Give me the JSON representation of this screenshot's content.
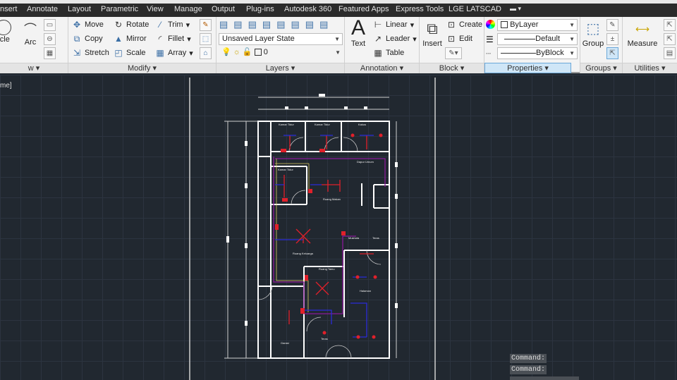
{
  "ribbon_tabs": [
    "nsert",
    "Annotate",
    "Layout",
    "Parametric",
    "View",
    "Manage",
    "Output",
    "Plug-ins",
    "Autodesk 360",
    "Featured Apps",
    "Express Tools",
    "LGE LATSCAD"
  ],
  "draw": {
    "label": "w",
    "circle": "rcle",
    "arc": "Arc"
  },
  "modify": {
    "label": "Modify",
    "move": "Move",
    "rotate": "Rotate",
    "trim": "Trim",
    "copy": "Copy",
    "mirror": "Mirror",
    "fillet": "Fillet",
    "stretch": "Stretch",
    "scale": "Scale",
    "array": "Array"
  },
  "layers": {
    "label": "Layers",
    "layer_state": "Unsaved Layer State",
    "current_layer": "0"
  },
  "annotation": {
    "label": "Annotation",
    "text": "Text",
    "linear": "Linear",
    "leader": "Leader",
    "table": "Table"
  },
  "block": {
    "label": "Block",
    "insert": "Insert",
    "create": "Create",
    "edit": "Edit"
  },
  "properties": {
    "label": "Properties",
    "color": "ByLayer",
    "lineweight": "Default",
    "linetype": "ByBlock"
  },
  "groups": {
    "label": "Groups",
    "group": "Group"
  },
  "utilities": {
    "label": "Utilities",
    "measure": "Measure"
  },
  "viewport_label": "me]",
  "rooms": [
    "Kamar Tidur",
    "Kamar Tidur",
    "Kakus",
    "Dapur Umum",
    "Kamar Tidur",
    "Ruang Makan",
    "Ruang Keluarga",
    "Mushola",
    "Teras",
    "Ruang Tamu",
    "Halaman",
    "Garasi",
    "Teras"
  ],
  "command_lines": [
    "Command:",
    "Command:"
  ],
  "colors": {
    "canvas": "#212830",
    "ribbon": "#f3f3f3",
    "tabs": "#2b2b2b",
    "wall": "#ffffff",
    "red": "#e0202a",
    "blue": "#2b2bd8",
    "purple": "#8a1a9a",
    "yellow": "#d8c860"
  }
}
